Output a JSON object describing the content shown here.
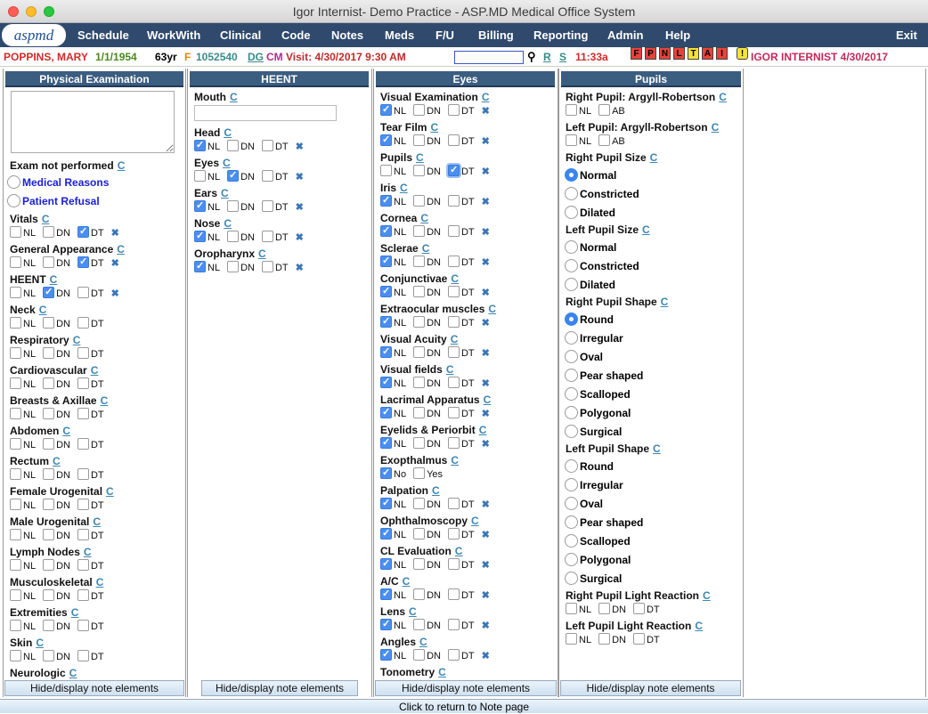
{
  "window": {
    "title": "Igor Internist- Demo Practice - ASP.MD Medical Office System"
  },
  "logo": "aspmd",
  "menu": [
    "Schedule",
    "WorkWith",
    "Clinical",
    "Code",
    "Notes",
    "Meds",
    "F/U",
    "Billing",
    "Reporting",
    "Admin",
    "Help",
    "Exit"
  ],
  "patient": {
    "name": "POPPINS, MARY",
    "dob": "1/1/1954",
    "age": "63yr",
    "sex": "F",
    "id": "1052540",
    "dg": "DG",
    "cm": "CM",
    "visit": "Visit: 4/30/2017 9:30 AM",
    "r": "R",
    "s": "S",
    "time": "11:33a",
    "flags": [
      "F",
      "P",
      "N",
      "L",
      "T",
      "A",
      "I",
      "!"
    ],
    "provider": "IGOR INTERNIST 4/30/2017"
  },
  "c": "C",
  "opts": {
    "nl": "NL",
    "dn": "DN",
    "dt": "DT",
    "no": "No",
    "yes": "Yes",
    "ab": "AB",
    "x": "✖"
  },
  "hide": "Hide/display note elements",
  "footer": "Click to return to Note page",
  "col1": {
    "title": "Physical Examination",
    "exam_not_performed": "Exam not performed",
    "medical_reasons": "Medical Reasons",
    "patient_refusal": "Patient Refusal",
    "items": [
      "Vitals",
      "General Appearance",
      "HEENT",
      "Neck",
      "Respiratory",
      "Cardiovascular",
      "Breasts & Axillae",
      "Abdomen",
      "Rectum",
      "Female Urogenital",
      "Male Urogenital",
      "Lymph Nodes",
      "Musculoskeletal",
      "Extremities",
      "Skin",
      "Neurologic"
    ]
  },
  "col2": {
    "title": "HEENT",
    "mouth": "Mouth",
    "items": [
      "Head",
      "Eyes",
      "Ears",
      "Nose",
      "Oropharynx"
    ]
  },
  "col3": {
    "title": "Eyes",
    "items": [
      "Visual Examination",
      "Tear Film",
      "Pupils",
      "Iris",
      "Cornea",
      "Sclerae",
      "Conjunctivae",
      "Extraocular muscles",
      "Visual Acuity",
      "Visual fields",
      "Lacrimal Apparatus",
      "Eyelids & Periorbit",
      "Exopthalmus",
      "Palpation",
      "Ophthalmoscopy",
      "CL Evaluation",
      "A/C",
      "Lens",
      "Angles",
      "Tonometry"
    ]
  },
  "col4": {
    "title": "Pupils",
    "rp_argyll": "Right Pupil: Argyll-Robertson",
    "lp_argyll": "Left Pupil: Argyll-Robertson",
    "rp_size": "Right Pupil Size",
    "lp_size": "Left Pupil Size",
    "size_opts": [
      "Normal",
      "Constricted",
      "Dilated"
    ],
    "rp_shape": "Right Pupil Shape",
    "lp_shape": "Left Pupil Shape",
    "shape_opts": [
      "Round",
      "Irregular",
      "Oval",
      "Pear shaped",
      "Scalloped",
      "Polygonal",
      "Surgical"
    ],
    "rp_light": "Right Pupil Light Reaction",
    "lp_light": "Left Pupil Light Reaction"
  }
}
